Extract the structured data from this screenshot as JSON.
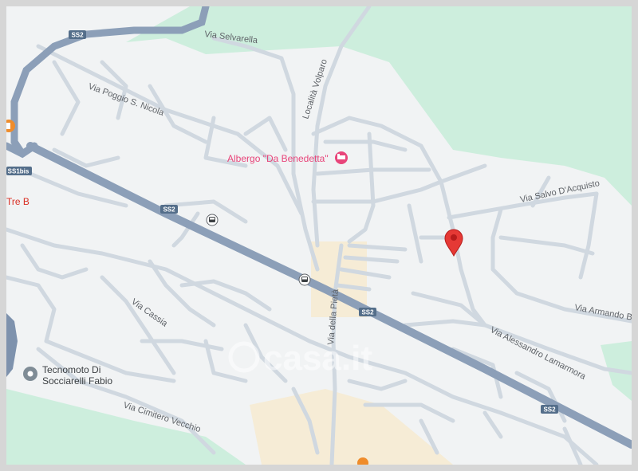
{
  "streets": {
    "via_selvarella": "Via Selvarella",
    "via_poggio_s_nicola": "Via Poggio S. Nicola",
    "localita_volparo": "Località Volparo",
    "via_salvo_dacquisto": "Via Salvo D'Acquisto",
    "via_armando": "Via Armando B",
    "via_alessandro_lamarmora": "Via Alessandro Lamarmora",
    "via_della_pieta": "Via della Pietà",
    "via_cassia": "Via Cassia",
    "via_cimitero_vecchio": "Via Cimitero Vecchio"
  },
  "road_shields": {
    "ss2_a": "SS2",
    "ss2_b": "SS2",
    "ss2_c": "SS2",
    "ss2_d": "SS2",
    "ss1bis": "SS1bis"
  },
  "pois": {
    "hotel": "Albergo \"Da Benedetta\"",
    "tre_b": "Tre B",
    "tecnomoto_line1": "Tecnomoto Di",
    "tecnomoto_line2": "Socciarelli Fabio"
  },
  "watermark": "casa.it",
  "colors": {
    "land": "#f1f3f4",
    "park": "#cdeedd",
    "highway": "#8c9fb8",
    "road": "#d0d8e0",
    "urban": "#f6ecd6",
    "hotel_pink": "#e8457a",
    "marker_red": "#e53935",
    "water": "#7e92ad"
  },
  "icons": [
    "bus-stop-icon",
    "hotel-icon",
    "restaurant-icon",
    "place-icon",
    "location-marker-icon"
  ]
}
